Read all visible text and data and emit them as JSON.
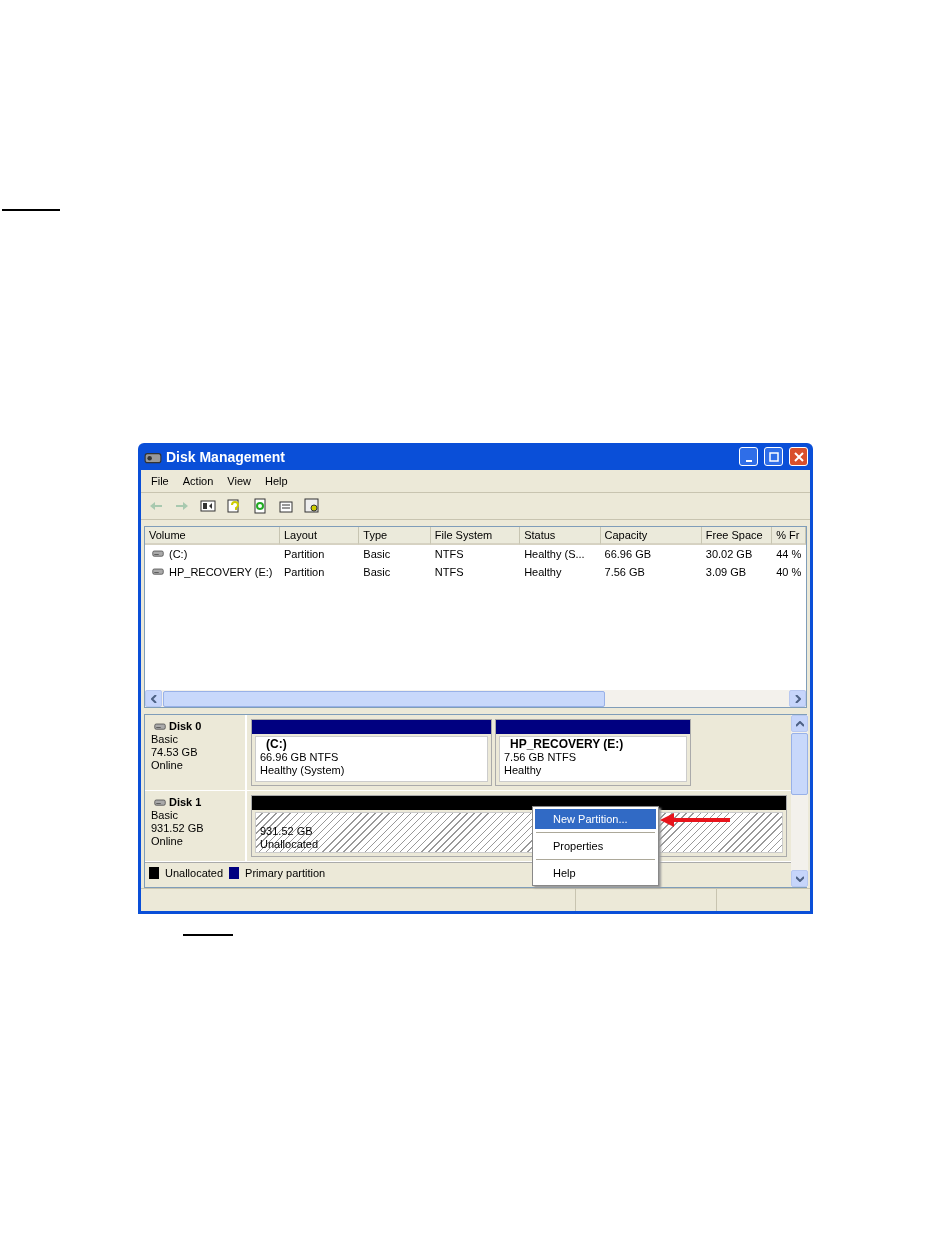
{
  "window": {
    "title": "Disk Management"
  },
  "menu": [
    "File",
    "Action",
    "View",
    "Help"
  ],
  "toolbar": [
    {
      "kind": "back",
      "disabled": true
    },
    {
      "kind": "forward",
      "disabled": true
    },
    {
      "kind": "tree",
      "disabled": false
    },
    {
      "kind": "help",
      "disabled": false
    },
    {
      "kind": "refresh",
      "disabled": false
    },
    {
      "kind": "properties",
      "disabled": false
    },
    {
      "kind": "settings",
      "disabled": false
    }
  ],
  "volume_table": {
    "columns": [
      "Volume",
      "Layout",
      "Type",
      "File System",
      "Status",
      "Capacity",
      "Free Space",
      "% Fr"
    ],
    "rows": [
      [
        "(C:)",
        "Partition",
        "Basic",
        "NTFS",
        "Healthy (S...",
        "66.96 GB",
        "30.02 GB",
        "44 %"
      ],
      [
        "HP_RECOVERY (E:)",
        "Partition",
        "Basic",
        "NTFS",
        "Healthy",
        "7.56 GB",
        "3.09 GB",
        "40 %"
      ]
    ]
  },
  "disks": [
    {
      "name": "Disk 0",
      "type": "Basic",
      "size": "74.53 GB",
      "status": "Online",
      "partitions": [
        {
          "kind": "primary",
          "title": "(C:)",
          "size": "66.96 GB NTFS",
          "status": "Healthy (System)"
        },
        {
          "kind": "primary",
          "title": "HP_RECOVERY  (E:)",
          "size": "7.56 GB NTFS",
          "status": "Healthy"
        }
      ]
    },
    {
      "name": "Disk 1",
      "type": "Basic",
      "size": "931.52 GB",
      "status": "Online",
      "partitions": [
        {
          "kind": "unallocated",
          "size": "931.52 GB",
          "status": "Unallocated"
        }
      ]
    }
  ],
  "legend": [
    {
      "label": "Unallocated",
      "color": "#000000"
    },
    {
      "label": "Primary partition",
      "color": "#000080"
    }
  ],
  "context_menu": [
    {
      "label": "New Partition...",
      "selected": true
    },
    {
      "label": "Properties",
      "selected": false
    },
    {
      "label": "Help",
      "selected": false
    }
  ]
}
